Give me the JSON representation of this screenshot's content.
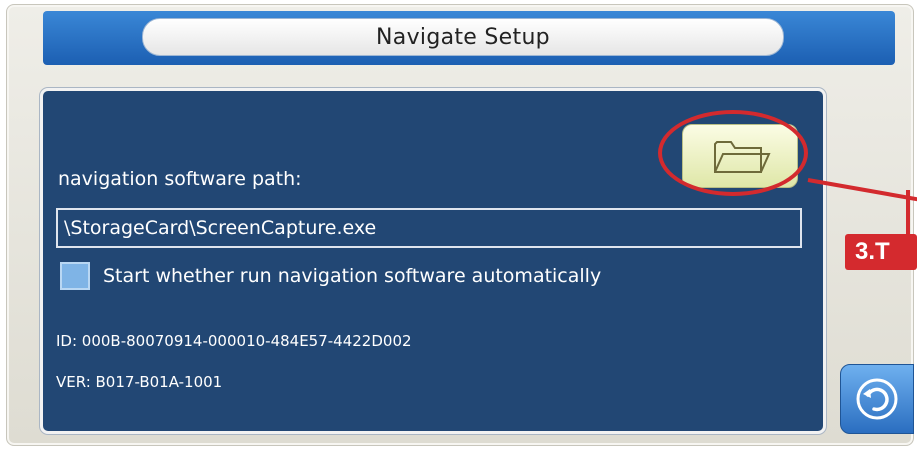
{
  "window": {
    "title": "Navigate Setup"
  },
  "form": {
    "path_label": "navigation software path:",
    "path_value": "\\StorageCard\\ScreenCapture.exe",
    "autostart_label": "Start whether run navigation software automatically",
    "autostart_checked": false
  },
  "info": {
    "id_text": "ID:  000B-80070914-000010-484E57-4422D002",
    "ver_text": "VER:  B017-B01A-1001"
  },
  "annotation": {
    "step_label": "3.T",
    "color": "#d32a2e"
  },
  "icons": {
    "browse": "folder-open-icon",
    "back": "back-arrow-icon"
  },
  "colors": {
    "panel": "#224774",
    "header": "#1c5fb2",
    "folder_button": "#dfe7a8",
    "checkbox": "#7fb4e6"
  }
}
